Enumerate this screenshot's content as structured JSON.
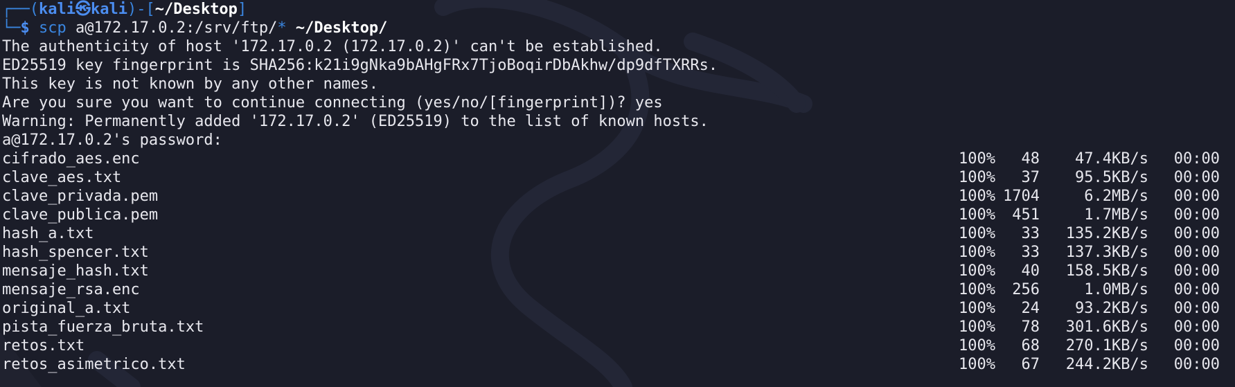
{
  "prompt": {
    "user": "kali",
    "at_glyph": "㉿",
    "host": "kali",
    "cwd": "~/Desktop",
    "dollar": "$"
  },
  "command": {
    "program": "scp",
    "arg_source": "a@172.17.0.2:/srv/ftp/",
    "arg_glob": "*",
    "arg_dest": "~/Desktop/"
  },
  "messages": [
    "The authenticity of host '172.17.0.2 (172.17.0.2)' can't be established.",
    "ED25519 key fingerprint is SHA256:k21i9gNka9bAHgFRx7TjoBoqirDbAkhw/dp9dfTXRRs.",
    "This key is not known by any other names.",
    "Are you sure you want to continue connecting (yes/no/[fingerprint])? yes",
    "Warning: Permanently added '172.17.0.2' (ED25519) to the list of known hosts.",
    "a@172.17.0.2's password: "
  ],
  "transfers": [
    {
      "name": "cifrado_aes.enc",
      "pct": "100%",
      "size": "48",
      "speed": "47.4KB/s",
      "time": "00:00"
    },
    {
      "name": "clave_aes.txt",
      "pct": "100%",
      "size": "37",
      "speed": "95.5KB/s",
      "time": "00:00"
    },
    {
      "name": "clave_privada.pem",
      "pct": "100%",
      "size": "1704",
      "speed": "6.2MB/s",
      "time": "00:00"
    },
    {
      "name": "clave_publica.pem",
      "pct": "100%",
      "size": "451",
      "speed": "1.7MB/s",
      "time": "00:00"
    },
    {
      "name": "hash_a.txt",
      "pct": "100%",
      "size": "33",
      "speed": "135.2KB/s",
      "time": "00:00"
    },
    {
      "name": "hash_spencer.txt",
      "pct": "100%",
      "size": "33",
      "speed": "137.3KB/s",
      "time": "00:00"
    },
    {
      "name": "mensaje_hash.txt",
      "pct": "100%",
      "size": "40",
      "speed": "158.5KB/s",
      "time": "00:00"
    },
    {
      "name": "mensaje_rsa.enc",
      "pct": "100%",
      "size": "256",
      "speed": "1.0MB/s",
      "time": "00:00"
    },
    {
      "name": "original_a.txt",
      "pct": "100%",
      "size": "24",
      "speed": "93.2KB/s",
      "time": "00:00"
    },
    {
      "name": "pista_fuerza_bruta.txt",
      "pct": "100%",
      "size": "78",
      "speed": "301.6KB/s",
      "time": "00:00"
    },
    {
      "name": "retos.txt",
      "pct": "100%",
      "size": "68",
      "speed": "270.1KB/s",
      "time": "00:00"
    },
    {
      "name": "retos_asimetrico.txt",
      "pct": "100%",
      "size": "67",
      "speed": "244.2KB/s",
      "time": "00:00"
    }
  ],
  "colors": {
    "background": "#1b1d29",
    "text": "#e8e8ee",
    "prompt_blue": "#3a86e0",
    "accent_white": "#ffffff"
  },
  "background_icon": "kali-dragon-watermark-icon"
}
